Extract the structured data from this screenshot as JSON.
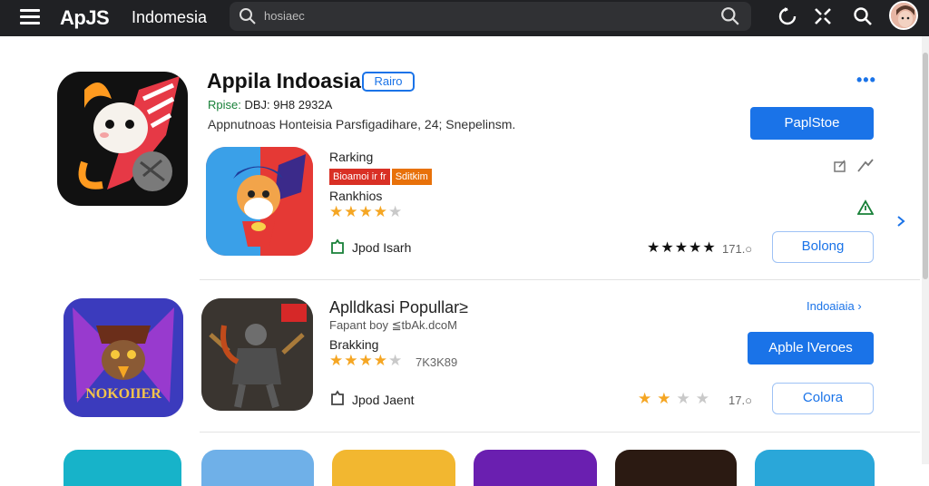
{
  "topbar": {
    "brand": "ApJS",
    "region": "Indomesia",
    "search_placeholder": "hosiaec"
  },
  "featured": {
    "title": "Appila Indoasia",
    "badge": "Rairo",
    "meta_green": "Rpise: ",
    "meta_rest": "DBJ: 9H8 2932A",
    "description": "Appnutnoas Honteisia Parsfigadihare, 24; Snepelinsm.",
    "more": "•••",
    "primary_button": "PaplStoe"
  },
  "item1": {
    "label_top": "Rarking",
    "tag_red": "Bioamoi ir fr",
    "tag_orange": "Sditkim",
    "label_rank": "Rankhios",
    "stars_on": 4,
    "stars_total": 5,
    "install_label": "Jpod Isarh",
    "rating_stars": "★★★★★",
    "rating_value": "171.○",
    "button": "Bolong"
  },
  "section": {
    "title": "Aplldkasi Popullar≥",
    "subtitle": "Fapant boy ≦tbAk.dcoM",
    "link": "Indoaiaia ›",
    "ranking_label": "Brakking",
    "stars_on": 4,
    "stars_total": 5,
    "count": "7K3K89",
    "install_label": "Jpod Jaent",
    "rating_on": 2,
    "rating_total": 5,
    "rating_value": "17.○",
    "primary_button": "Apble lVeroes",
    "outline_button": "Colora"
  },
  "colors": {
    "accent": "#1a73e8",
    "topbar": "#202124",
    "star": "#f5a623",
    "green": "#188038",
    "red_tag": "#d93025",
    "orange_tag": "#e8710a"
  }
}
